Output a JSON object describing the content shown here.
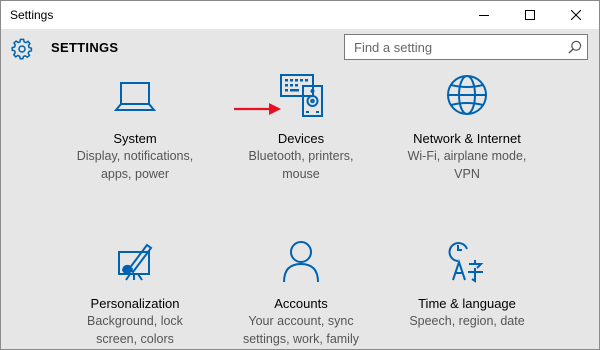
{
  "window": {
    "title": "Settings",
    "controls": {
      "minimize_icon": "minimize-icon",
      "maximize_icon": "maximize-icon",
      "close_icon": "close-icon"
    }
  },
  "header": {
    "icon": "gear-icon",
    "title": "SETTINGS",
    "search": {
      "placeholder": "Find a setting",
      "value": "",
      "icon": "search-icon"
    }
  },
  "colors": {
    "accent": "#0063b1",
    "annotation_arrow": "#e81123",
    "background": "#e6e6e6"
  },
  "tiles": [
    {
      "icon": "laptop-icon",
      "title": "System",
      "desc_line1": "Display, notifications,",
      "desc_line2": "apps, power"
    },
    {
      "icon": "devices-icon",
      "title": "Devices",
      "desc_line1": "Bluetooth, printers,",
      "desc_line2": "mouse"
    },
    {
      "icon": "globe-icon",
      "title": "Network & Internet",
      "desc_line1": "Wi-Fi, airplane mode,",
      "desc_line2": "VPN"
    },
    {
      "icon": "personalization-icon",
      "title": "Personalization",
      "desc_line1": "Background, lock",
      "desc_line2": "screen, colors"
    },
    {
      "icon": "person-icon",
      "title": "Accounts",
      "desc_line1": "Your account, sync",
      "desc_line2": "settings, work, family"
    },
    {
      "icon": "time-language-icon",
      "title": "Time & language",
      "desc_line1": "Speech, region, date",
      "desc_line2": ""
    }
  ],
  "annotation": {
    "icon": "red-arrow-icon"
  }
}
